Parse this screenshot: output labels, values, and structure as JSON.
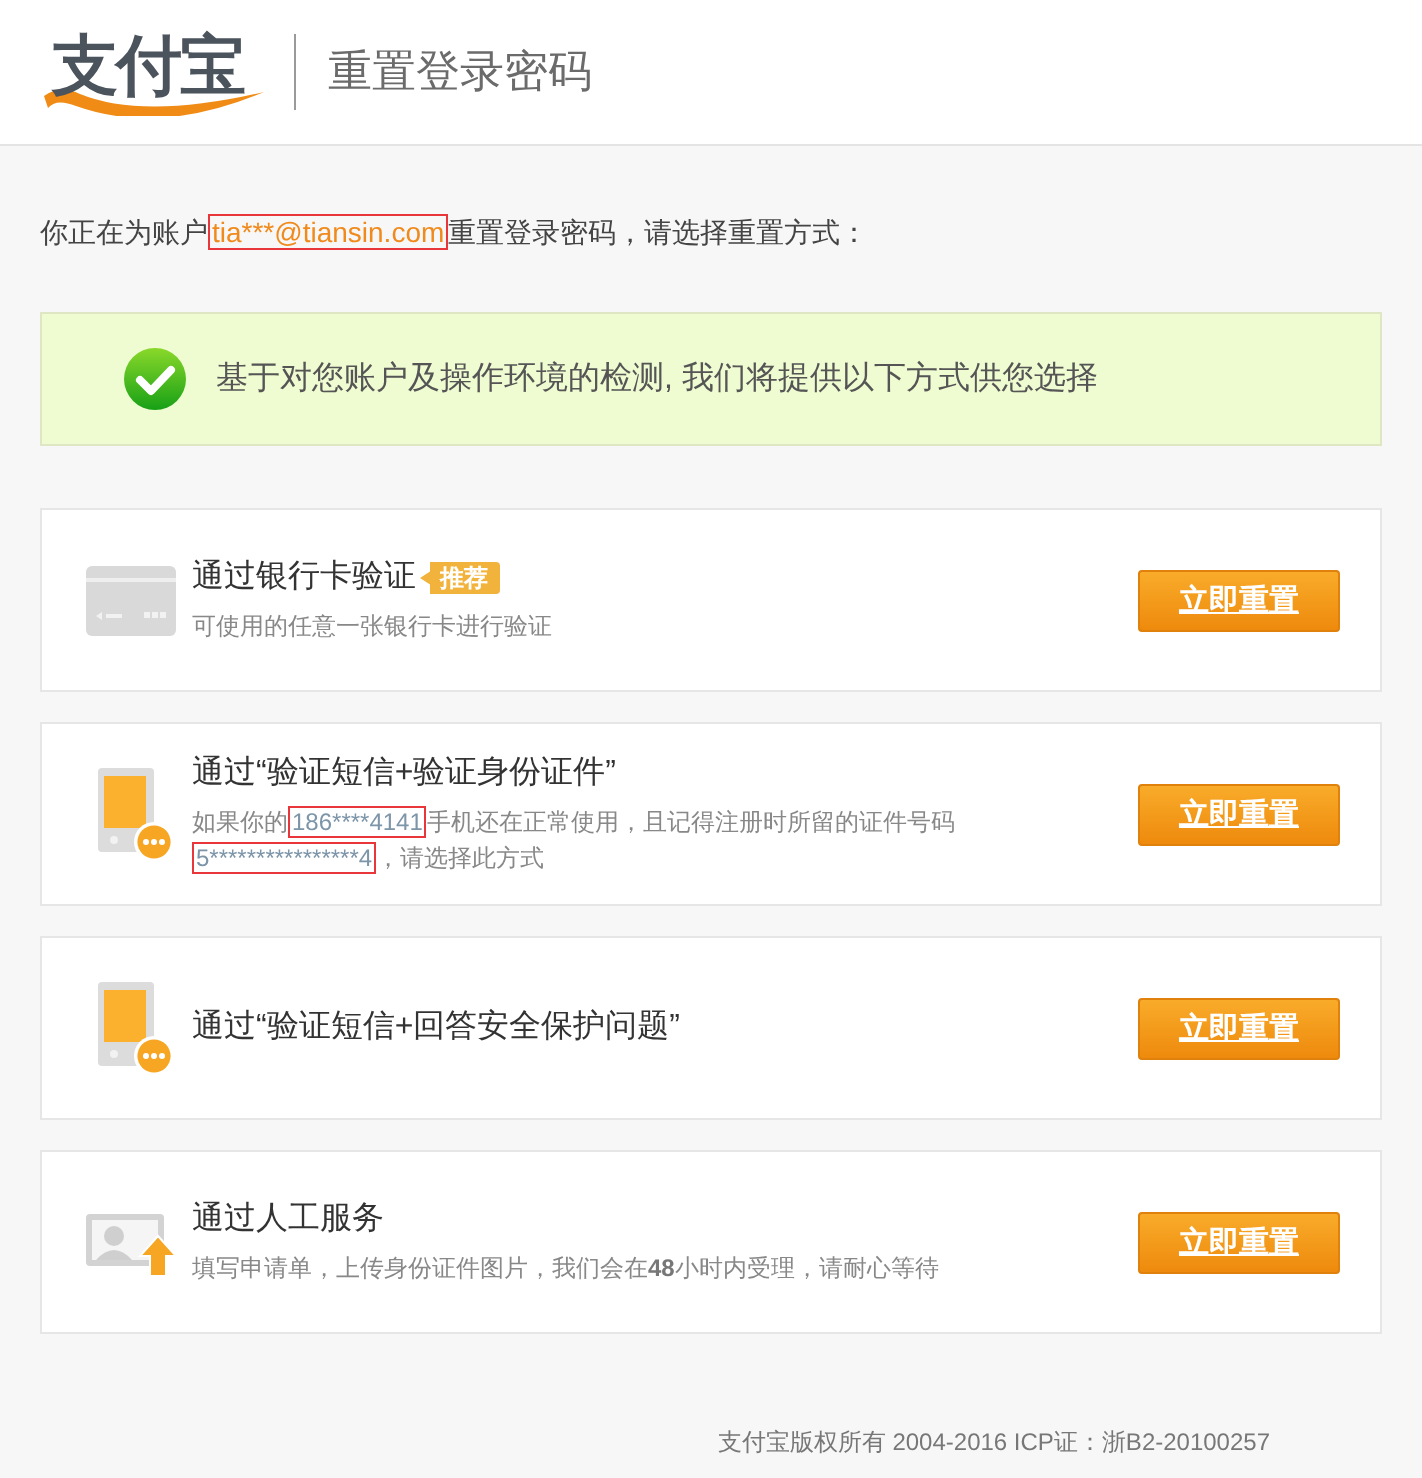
{
  "header": {
    "logo": "支付宝",
    "title": "重置登录密码"
  },
  "intro": [
    {
      "text": "你正在为账户",
      "boxed": false
    },
    {
      "text": "tia***@tiansin.com",
      "boxed": true
    },
    {
      "text": "重置登录密码，请选择重置方式：",
      "boxed": false
    }
  ],
  "notice": {
    "text": "基于对您账户及操作环境的检测, 我们将提供以下方式供您选择"
  },
  "methods": [
    {
      "kind": "bank-card",
      "title": "通过银行卡验证",
      "badge": "推荐",
      "lines": [
        [
          {
            "text": "可使用的任意一张银行卡进行验证",
            "boxed": false
          }
        ]
      ],
      "button": "立即重置"
    },
    {
      "kind": "phone",
      "title": "通过“验证短信+验证身份证件”",
      "lines": [
        [
          {
            "text": "如果你的",
            "boxed": false
          },
          {
            "text": "186****4141",
            "boxed": true
          },
          {
            "text": "手机还在正常使用，且记得注册时所留的证件号码",
            "boxed": false
          }
        ],
        [
          {
            "text": "5****************4",
            "boxed": true
          },
          {
            "text": "，请选择此方式",
            "boxed": false
          }
        ]
      ],
      "button": "立即重置"
    },
    {
      "kind": "phone",
      "title": "通过“验证短信+回答安全保护问题”",
      "button": "立即重置"
    },
    {
      "kind": "manual",
      "title": "通过人工服务",
      "lines": [
        [
          {
            "text": "填写申请单，上传身份证件图片，我们会在**48**小时内受理，请耐心等待",
            "boxed": false
          }
        ]
      ],
      "button": "立即重置"
    }
  ],
  "footer": "支付宝版权所有 2004-2016 ICP证：浙B2-20100257"
}
